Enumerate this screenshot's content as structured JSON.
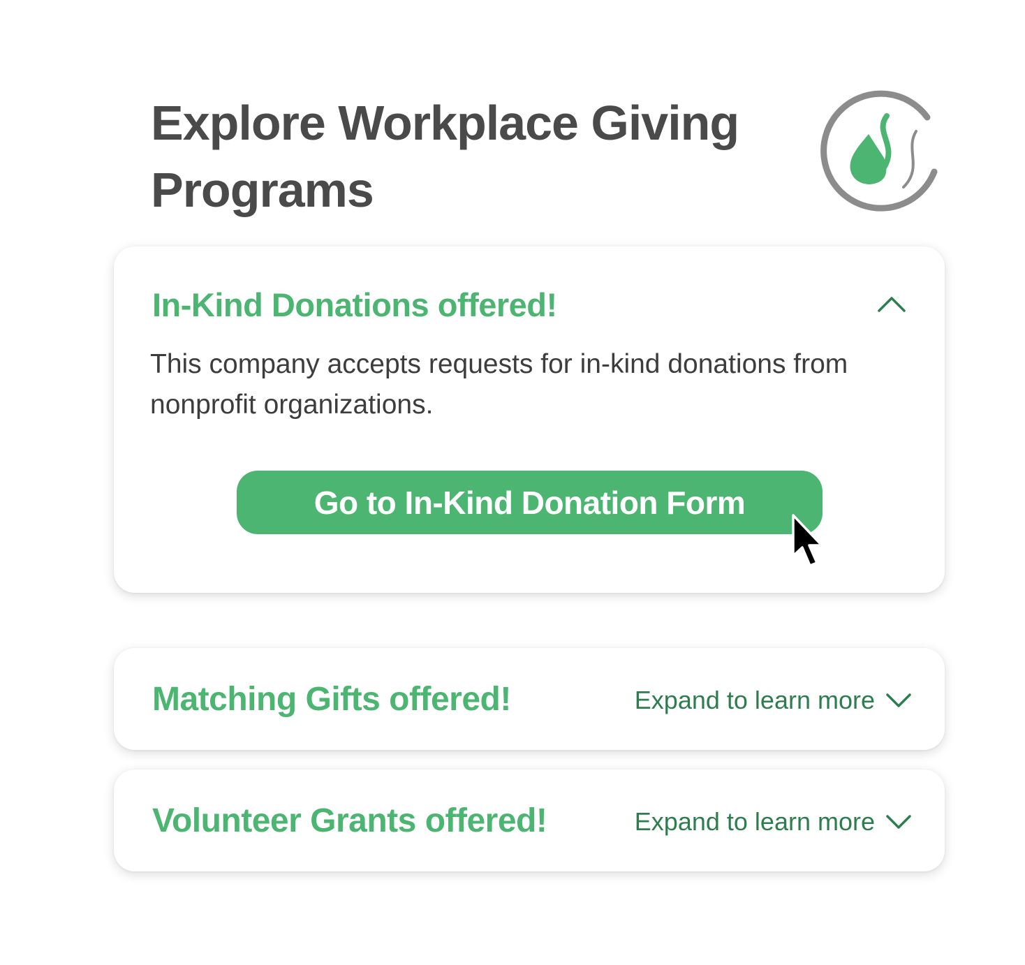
{
  "header": {
    "title": "Explore Workplace Giving Programs"
  },
  "programs": [
    {
      "title": "In-Kind Donations offered!",
      "expanded": true,
      "description": "This company accepts requests for in-kind donations from nonprofit organizations.",
      "button_label": "Go to In-Kind Donation Form"
    },
    {
      "title": "Matching Gifts offered!",
      "expanded": false,
      "expand_label": "Expand to learn more"
    },
    {
      "title": "Volunteer Grants offered!",
      "expanded": false,
      "expand_label": "Expand to learn more"
    }
  ],
  "icons": {
    "logo": "brand-logo-icon",
    "collapse": "chevron-up-icon",
    "expand": "chevron-down-icon",
    "cursor": "mouse-pointer-icon"
  },
  "colors": {
    "brand_green": "#4db572",
    "dark_green": "#2e7d4f",
    "title_gray": "#4a4a4a",
    "text_gray": "#3d3d3d",
    "logo_ring_gray": "#8c8c8c"
  }
}
